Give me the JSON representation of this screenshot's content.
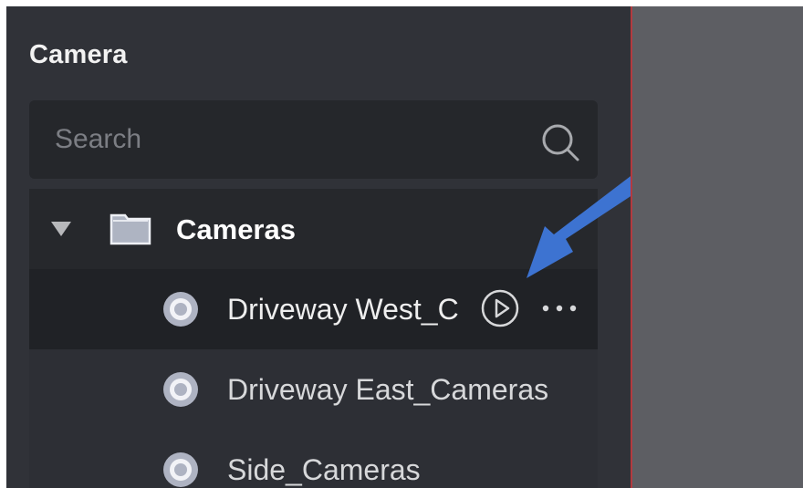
{
  "panel": {
    "title": "Camera"
  },
  "search": {
    "placeholder": "Search",
    "icon": "search-icon"
  },
  "tree": {
    "group": {
      "label": "Cameras",
      "expanded": true,
      "expand_icon": "triangle-down-icon",
      "icon": "folder-icon"
    },
    "items": [
      {
        "label": "Driveway West_C",
        "selected": true,
        "actions": [
          "play-icon",
          "more-icon"
        ]
      },
      {
        "label": "Driveway East_Cameras",
        "selected": false
      },
      {
        "label": "Side_Cameras",
        "selected": false
      }
    ]
  },
  "colors": {
    "panel_bg": "#303238",
    "search_bg": "#25272b",
    "selected_row_bg": "#202226",
    "divider": "#b33a3f",
    "viewport_bg": "#5d5e63",
    "annotation_arrow": "#3d73d1"
  }
}
